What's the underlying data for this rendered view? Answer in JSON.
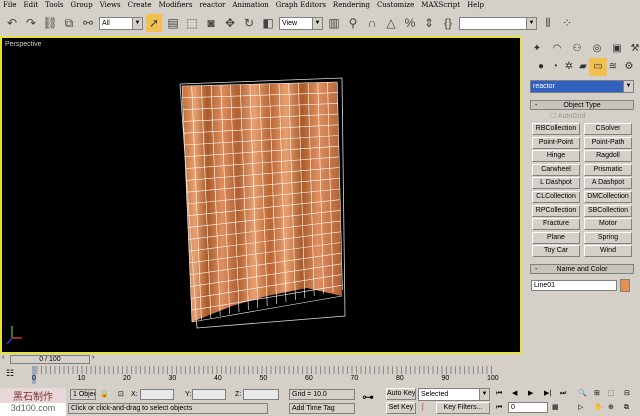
{
  "menu": [
    "File",
    "Edit",
    "Tools",
    "Group",
    "Views",
    "Create",
    "Modifiers",
    "reactor",
    "Animation",
    "Graph Editors",
    "Rendering",
    "Customize",
    "MAXScript",
    "Help"
  ],
  "toolbar": {
    "selection_filter": "All",
    "reference_coord": "View",
    "named_selection": ""
  },
  "viewport": {
    "label": "Perspective"
  },
  "command_panel": {
    "category": "reactor",
    "object_type_title": "Object Type",
    "autogrid": "AutoGrid",
    "buttons": [
      "RBCollection",
      "CSolver",
      "Point-Point",
      "Point-Path",
      "Hinge",
      "Ragdoll",
      "Carwheel",
      "Prismatic",
      "L Dashpot",
      "A Dashpot",
      "CLCollection",
      "DMCollection",
      "RPCollection",
      "SBCollection",
      "Fracture",
      "Motor",
      "Plane",
      "Spring",
      "Toy Car",
      "Wind"
    ],
    "name_color_title": "Name and Color",
    "object_name": "Line01",
    "object_color": "#e8904c"
  },
  "timeline": {
    "slider": "0 / 100",
    "ticks": [
      "0",
      "10",
      "20",
      "30",
      "40",
      "50",
      "60",
      "70",
      "80",
      "90",
      "100"
    ]
  },
  "status": {
    "selection": "1 Objec",
    "x_label": "X:",
    "y_label": "Y:",
    "z_label": "Z:",
    "grid": "Grid = 10.0",
    "prompt": "Click or click-and-drag to select objects",
    "add_time_tag": "Add Time Tag",
    "auto_key": "Auto Key",
    "set_key": "Set Key",
    "key_mode": "Selected",
    "key_filters": "Key Filters...",
    "frame": "0"
  },
  "watermark": {
    "line1": "黑石制作",
    "line2": "3d100.com"
  }
}
